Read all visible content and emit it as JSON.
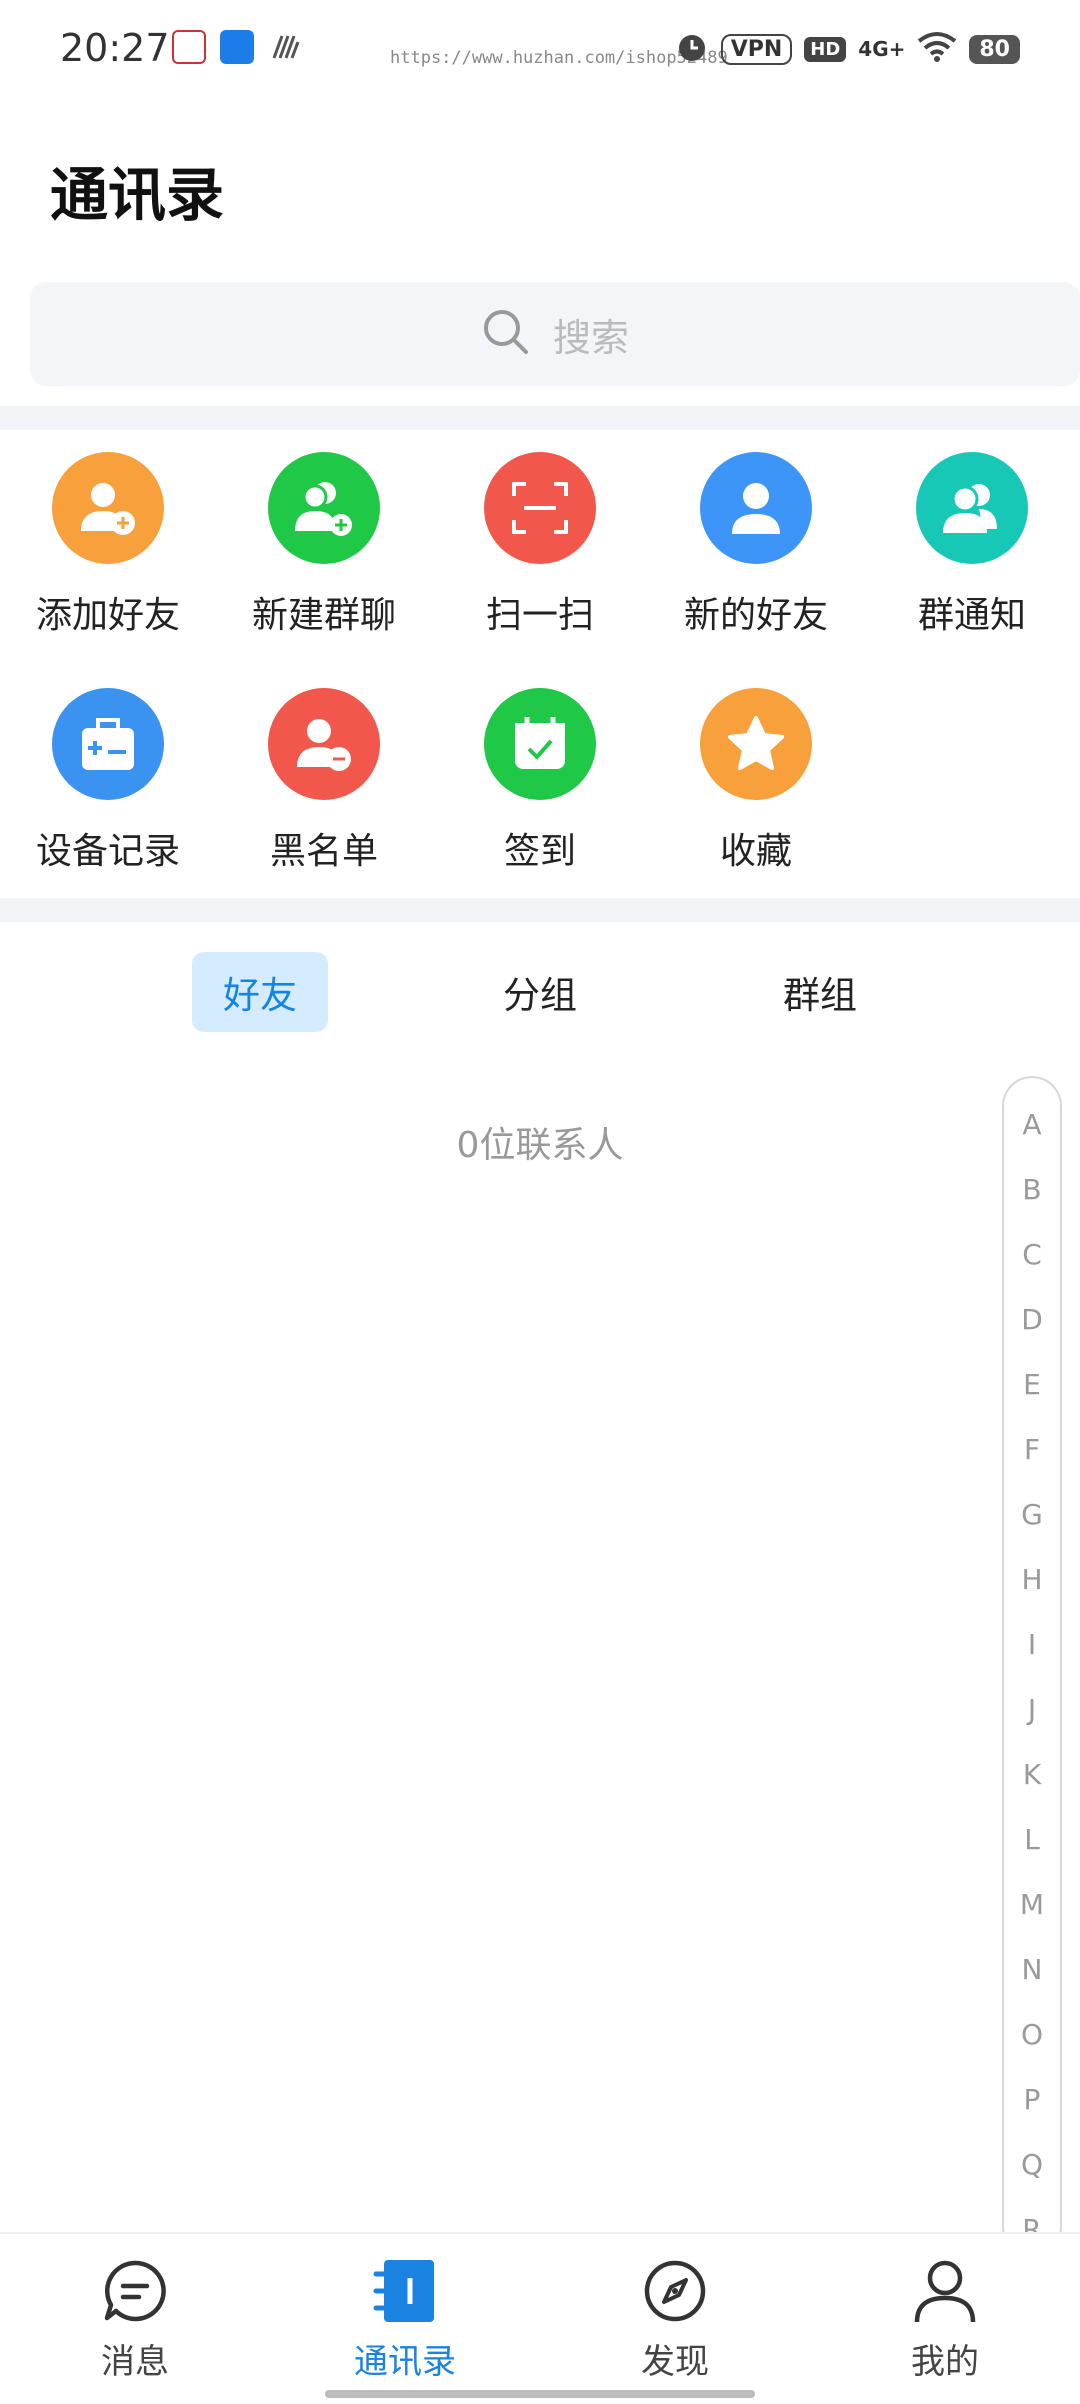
{
  "status_bar": {
    "time": "20:27",
    "url_watermark": "https://www.huzhan.com/ishop52489",
    "vpn": "VPN",
    "hd": "HD",
    "network": "4G+",
    "battery": "80"
  },
  "header": {
    "title": "通讯录"
  },
  "search": {
    "placeholder": "搜索"
  },
  "grid": {
    "items": [
      {
        "label": "添加好友",
        "icon": "add-friend-icon",
        "color": "#f7a03c"
      },
      {
        "label": "新建群聊",
        "icon": "new-group-icon",
        "color": "#1fc846"
      },
      {
        "label": "扫一扫",
        "icon": "scan-icon",
        "color": "#f2574b"
      },
      {
        "label": "新的好友",
        "icon": "new-friend-icon",
        "color": "#3d96f7"
      },
      {
        "label": "群通知",
        "icon": "group-notice-icon",
        "color": "#16c8b5"
      },
      {
        "label": "设备记录",
        "icon": "device-record-icon",
        "color": "#3a93f0"
      },
      {
        "label": "黑名单",
        "icon": "blacklist-icon",
        "color": "#f2574b"
      },
      {
        "label": "签到",
        "icon": "check-in-icon",
        "color": "#1fc846"
      },
      {
        "label": "收藏",
        "icon": "favorites-icon",
        "color": "#f7a03c"
      }
    ]
  },
  "tabs": [
    {
      "label": "好友",
      "active": true
    },
    {
      "label": "分组",
      "active": false
    },
    {
      "label": "群组",
      "active": false
    }
  ],
  "contacts": {
    "count_text": "0位联系人"
  },
  "index_letters": [
    "A",
    "B",
    "C",
    "D",
    "E",
    "F",
    "G",
    "H",
    "I",
    "J",
    "K",
    "L",
    "M",
    "N",
    "O",
    "P",
    "Q",
    "R"
  ],
  "bottom_nav": [
    {
      "label": "消息",
      "icon": "message-icon",
      "active": false
    },
    {
      "label": "通讯录",
      "icon": "contacts-icon",
      "active": true
    },
    {
      "label": "发现",
      "icon": "compass-icon",
      "active": false
    },
    {
      "label": "我的",
      "icon": "profile-icon",
      "active": false
    }
  ],
  "colors": {
    "accent": "#1a82e0",
    "tab_active_bg": "#d5ebff"
  }
}
